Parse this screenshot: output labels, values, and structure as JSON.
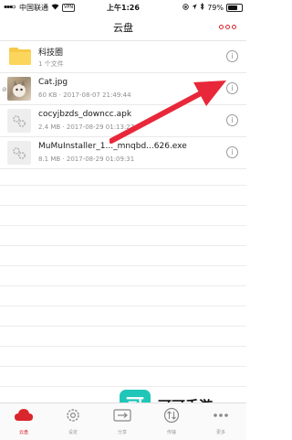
{
  "status_bar": {
    "carrier": "中国联通",
    "vpn": "VPN",
    "time": "上午1:26",
    "battery_percent": "79%",
    "battery_level": 0.79
  },
  "nav": {
    "title": "云盘"
  },
  "files": [
    {
      "name": "科技圈",
      "meta": "1 个文件",
      "kind": "folder"
    },
    {
      "name": "Cat.jpg",
      "meta": "60 KB · 2017-08-07 21:49:44",
      "kind": "image"
    },
    {
      "name": "cocyjbzds_downcc.apk",
      "meta": "2.4 MB · 2017-08-29 01:13:27",
      "kind": "file"
    },
    {
      "name": "MuMuInstaller_1..._mnqbd...626.exe",
      "meta": "8.1 MB · 2017-08-29 01:09:31",
      "kind": "file"
    }
  ],
  "tabs": [
    {
      "label": "云盘",
      "icon": "cloud-icon",
      "active": true
    },
    {
      "label": "设定",
      "icon": "gear-icon",
      "active": false
    },
    {
      "label": "分享",
      "icon": "share-icon",
      "active": false
    },
    {
      "label": "传输",
      "icon": "transfer-icon",
      "active": false
    },
    {
      "label": "更多",
      "icon": "more-icon",
      "active": false
    }
  ],
  "watermark": {
    "logo_char": "可",
    "text": "可可手游"
  },
  "colors": {
    "accent": "#d9262c",
    "watermark": "#20c6b8",
    "arrow": "#e8283a"
  }
}
